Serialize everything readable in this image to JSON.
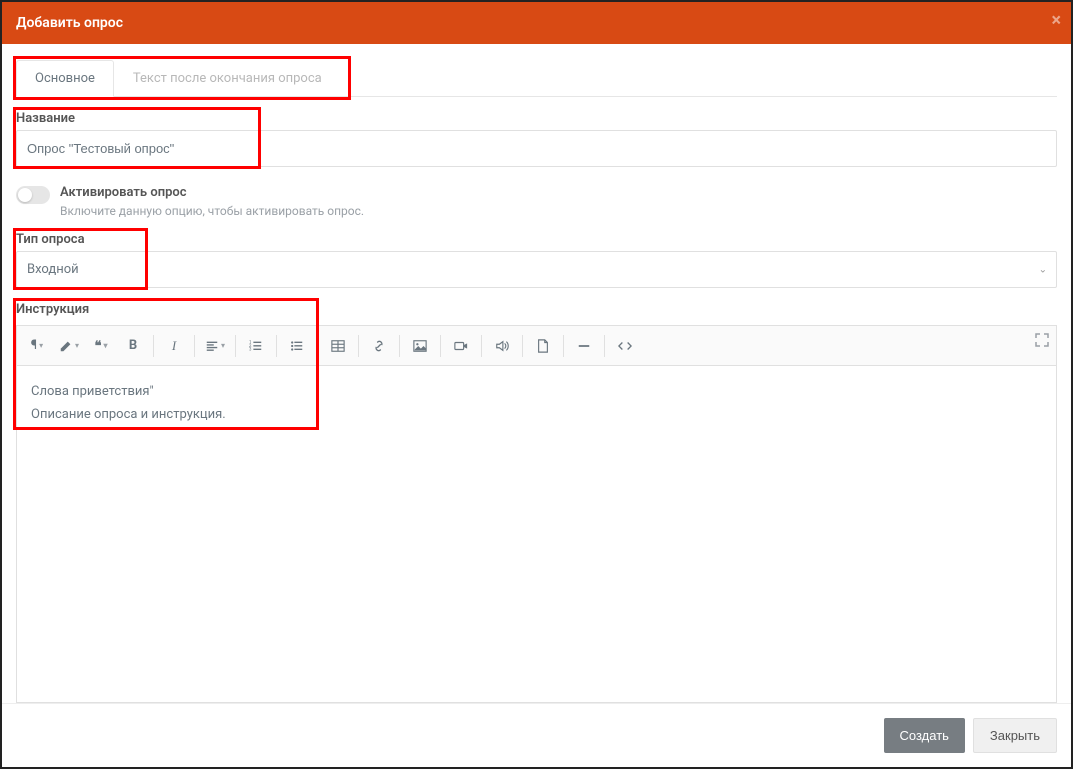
{
  "header": {
    "title": "Добавить опрос"
  },
  "tabs": {
    "main": "Основное",
    "after": "Текст после окончания опроса"
  },
  "name": {
    "label": "Название",
    "value": "Опрос \"Тестовый опрос\""
  },
  "activate": {
    "label": "Активировать опрос",
    "hint": "Включите данную опцию, чтобы активировать опрос."
  },
  "type": {
    "label": "Тип опроса",
    "value": "Входной"
  },
  "instruction": {
    "label": "Инструкция",
    "line1": "Слова приветствия\"",
    "line2": "Описание опроса и инструкция."
  },
  "footer": {
    "create": "Создать",
    "close": "Закрыть"
  }
}
